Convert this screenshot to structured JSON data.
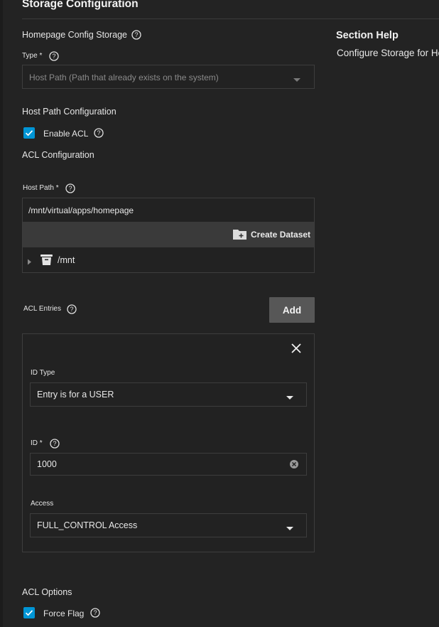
{
  "page": {
    "title": "Storage Configuration"
  },
  "help": {
    "title": "Section Help",
    "text": "Configure Storage for Homepage"
  },
  "homepage_config_storage": {
    "label": "Homepage Config Storage",
    "type_label": "Type *",
    "type_value": "Host Path (Path that already exists on the system)"
  },
  "host_path_config": {
    "label": "Host Path Configuration",
    "enable_acl_label": "Enable ACL",
    "enable_acl_checked": true,
    "acl_config_label": "ACL Configuration"
  },
  "host_path": {
    "label": "Host Path *",
    "value": "/mnt/virtual/apps/homepage",
    "create_dataset_label": "Create Dataset",
    "tree_root": "/mnt"
  },
  "acl_entries": {
    "label": "ACL Entries",
    "add_label": "Add",
    "entry": {
      "id_type_label": "ID Type",
      "id_type_value": "Entry is for a USER",
      "id_label": "ID *",
      "id_value": "1000",
      "access_label": "Access",
      "access_value": "FULL_CONTROL Access"
    }
  },
  "acl_options": {
    "label": "ACL Options",
    "force_flag_label": "Force Flag",
    "force_flag_checked": true
  },
  "colors": {
    "background": "#232323",
    "accent": "#0095d5",
    "button": "#575757"
  },
  "icons": [
    "help-icon",
    "chevron-down-icon",
    "check-icon",
    "folder-plus-icon",
    "caret-right-icon",
    "dataset-icon",
    "close-icon",
    "clear-icon"
  ]
}
